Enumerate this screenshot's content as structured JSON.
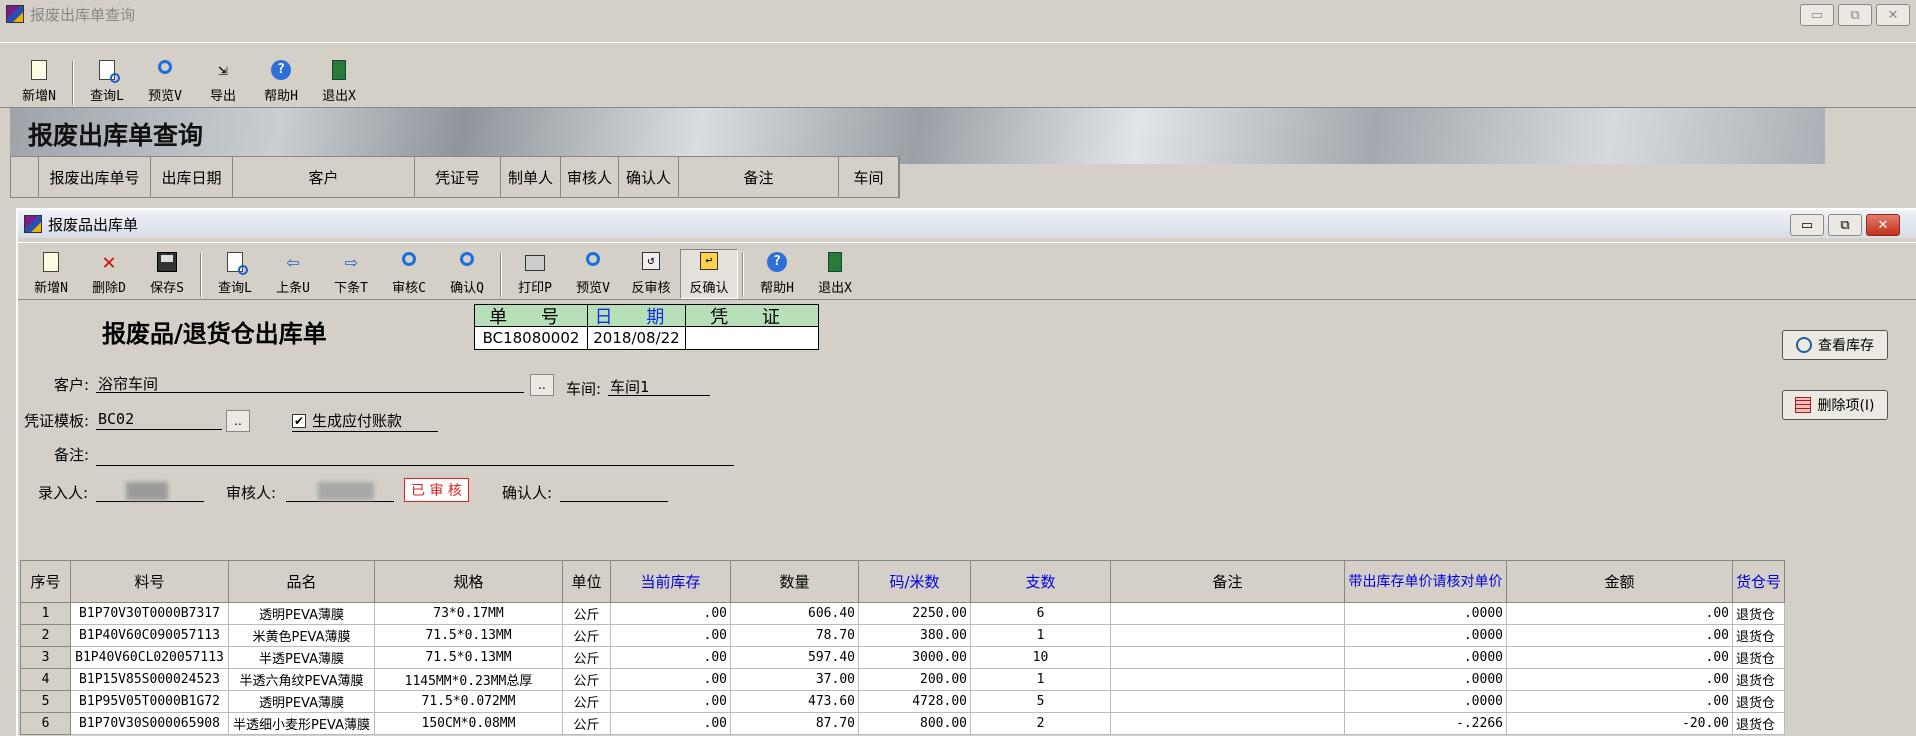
{
  "outer": {
    "title": "报废出库单查询",
    "toolbar": [
      {
        "label": "新增N",
        "icon": "new-doc-icon"
      },
      {
        "label": "查询L",
        "icon": "query-doc-icon"
      },
      {
        "label": "预览V",
        "icon": "preview-magnifier-icon"
      },
      {
        "label": "导出",
        "icon": "export-icon"
      },
      {
        "label": "帮助H",
        "icon": "help-icon"
      },
      {
        "label": "退出X",
        "icon": "exit-door-icon"
      }
    ],
    "banner": "报废出库单查询",
    "columns": [
      "报废出库单号",
      "出库日期",
      "客户",
      "凭证号",
      "制单人",
      "审核人",
      "确认人",
      "备注",
      "车间"
    ]
  },
  "inner": {
    "title": "报废品出库单",
    "toolbar": [
      {
        "label": "新增N",
        "icon": "new-doc-icon"
      },
      {
        "label": "删除D",
        "icon": "delete-x-icon"
      },
      {
        "label": "保存S",
        "icon": "save-disk-icon"
      },
      {
        "label": "查询L",
        "icon": "query-doc-icon"
      },
      {
        "label": "上条U",
        "icon": "prev-arrow-icon"
      },
      {
        "label": "下条T",
        "icon": "next-arrow-icon"
      },
      {
        "label": "审核C",
        "icon": "audit-magnifier-icon"
      },
      {
        "label": "确认Q",
        "icon": "confirm-magnifier-icon"
      },
      {
        "label": "打印P",
        "icon": "printer-icon"
      },
      {
        "label": "预览V",
        "icon": "preview-magnifier-icon"
      },
      {
        "label": "反审核",
        "icon": "unaudit-icon"
      },
      {
        "label": "反确认",
        "icon": "unconfirm-icon"
      },
      {
        "label": "帮助H",
        "icon": "help-icon"
      },
      {
        "label": "退出X",
        "icon": "exit-door-icon"
      }
    ]
  },
  "form": {
    "heading": "报废品/退货仓出库单",
    "doc_headers": [
      "单 号",
      "日 期",
      "凭 证"
    ],
    "doc_no": "BC18080002",
    "doc_date": "2018/08/22",
    "doc_voucher": "",
    "customer_label": "客户:",
    "customer": "浴帘车间",
    "workshop_label": "车间:",
    "workshop": "车间1",
    "template_label": "凭证模板:",
    "template": "BC02",
    "gen_payable_label": "生成应付账款",
    "gen_payable_checked": true,
    "remark_label": "备注:",
    "remark": "",
    "entry_label": "录入人:",
    "auditor_label": "审核人:",
    "audited_stamp": "已 审 核",
    "confirmer_label": "确认人:",
    "check_stock_btn": "查看库存",
    "delete_item_btn": "删除项(I)"
  },
  "grid": {
    "headers": [
      "序号",
      "料号",
      "品名",
      "规格",
      "单位",
      "当前库存",
      "数量",
      "码/米数",
      "支数",
      "备注",
      "带出库存单价请核对单价",
      "金额",
      "货仓号"
    ],
    "rows": [
      [
        "1",
        "B1P70V30T0000B7317",
        "透明PEVA薄膜",
        "73*0.17MM",
        "公斤",
        ".00",
        "606.40",
        "2250.00",
        "6",
        "",
        ".0000",
        ".00",
        "退货仓"
      ],
      [
        "2",
        "B1P40V60C090057113",
        "米黄色PEVA薄膜",
        "71.5*0.13MM",
        "公斤",
        ".00",
        "78.70",
        "380.00",
        "1",
        "",
        ".0000",
        ".00",
        "退货仓"
      ],
      [
        "3",
        "B1P40V60CL020057113",
        "半透PEVA薄膜",
        "71.5*0.13MM",
        "公斤",
        ".00",
        "597.40",
        "3000.00",
        "10",
        "",
        ".0000",
        ".00",
        "退货仓"
      ],
      [
        "4",
        "B1P15V85S000024523",
        "半透六角纹PEVA薄膜",
        "1145MM*0.23MM总厚",
        "公斤",
        ".00",
        "37.00",
        "200.00",
        "1",
        "",
        ".0000",
        ".00",
        "退货仓"
      ],
      [
        "5",
        "B1P95V05T0000B1G72",
        "透明PEVA薄膜",
        "71.5*0.072MM",
        "公斤",
        ".00",
        "473.60",
        "4728.00",
        "5",
        "",
        ".0000",
        ".00",
        "退货仓"
      ],
      [
        "6",
        "B1P70V30S000065908",
        "半透细小麦形PEVA薄膜",
        "150CM*0.08MM",
        "公斤",
        ".00",
        "87.70",
        "800.00",
        "2",
        "",
        "-.2266",
        "-20.00",
        "退货仓"
      ]
    ]
  }
}
